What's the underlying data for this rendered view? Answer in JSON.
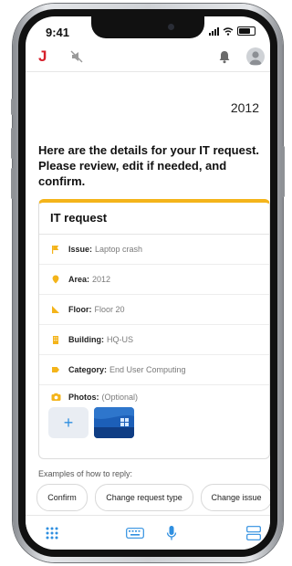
{
  "status": {
    "time": "9:41"
  },
  "header": {
    "logo": "J"
  },
  "conversation": {
    "year": "2012",
    "intro": "Here are the details for your IT request. Please review, edit if needed, and confirm."
  },
  "card": {
    "title": "IT request",
    "accent_color": "#f4b41a",
    "fields": [
      {
        "label": "Issue:",
        "value": "Laptop crash",
        "icon": "flag-icon"
      },
      {
        "label": "Area:",
        "value": "2012",
        "icon": "location-pin-icon"
      },
      {
        "label": "Floor:",
        "value": "Floor 20",
        "icon": "floor-icon"
      },
      {
        "label": "Building:",
        "value": "HQ-US",
        "icon": "building-icon"
      },
      {
        "label": "Category:",
        "value": "End User Computing",
        "icon": "tag-icon"
      }
    ],
    "photos": {
      "label": "Photos:",
      "hint": "(Optional)",
      "icon": "camera-icon",
      "add_label": "+"
    }
  },
  "examples": {
    "label": "Examples of how to reply:",
    "chips": [
      "Confirm",
      "Change request type",
      "Change issue"
    ]
  },
  "colors": {
    "brand_red": "#d6202b",
    "accent_yellow": "#f4b41a",
    "icon_blue": "#2f8fe0"
  }
}
